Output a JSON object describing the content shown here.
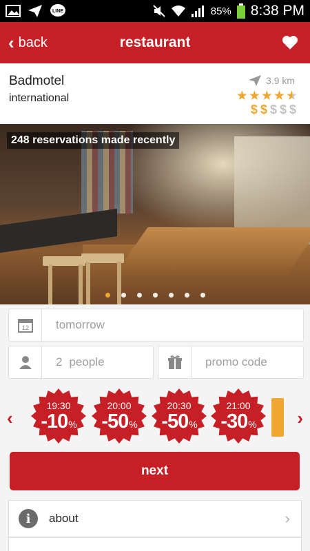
{
  "status_bar": {
    "battery": "85%",
    "time": "8:38 PM",
    "icons": [
      "image-icon",
      "send-icon",
      "line-icon",
      "mute-icon",
      "wifi-icon",
      "signal-icon",
      "battery-icon"
    ]
  },
  "app_bar": {
    "back_label": "back",
    "title": "restaurant",
    "favorite_icon": "heart-icon"
  },
  "restaurant": {
    "name": "Badmotel",
    "cuisine": "international",
    "distance": "3.9 km",
    "rating_stars": 4.5,
    "price_level": 2,
    "price_max": 5,
    "price_symbol": "$"
  },
  "photo": {
    "reservations_text": "248 reservations made recently",
    "slide_count": 7,
    "active_slide": 1
  },
  "form": {
    "date_value": "tomorrow",
    "people_count": "2",
    "people_label": "people",
    "promo_placeholder": "promo code"
  },
  "deals": [
    {
      "time": "19:30",
      "discount": "-10",
      "unit": "%"
    },
    {
      "time": "20:00",
      "discount": "-50",
      "unit": "%"
    },
    {
      "time": "20:30",
      "discount": "-50",
      "unit": "%"
    },
    {
      "time": "21:00",
      "discount": "-30",
      "unit": "%"
    }
  ],
  "next_label": "next",
  "about_label": "about",
  "colors": {
    "primary_red": "#c61f25",
    "star_gold": "#f0a732",
    "muted_gray": "#9e9e9e"
  }
}
